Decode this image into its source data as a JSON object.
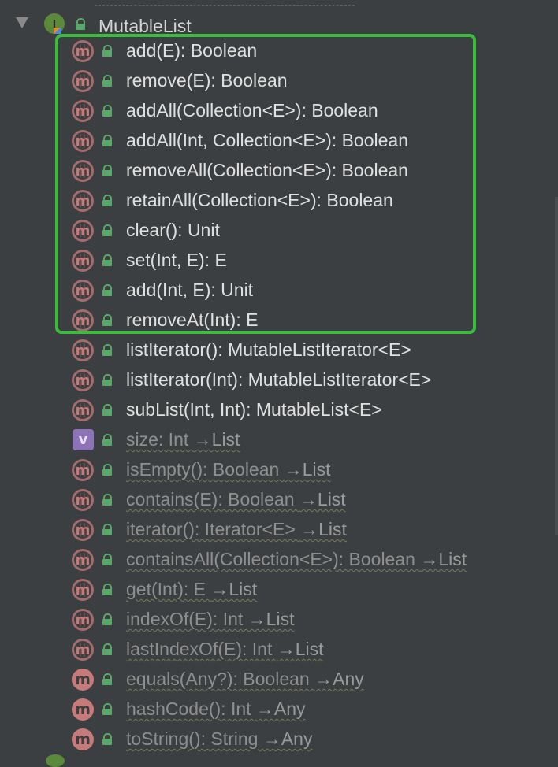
{
  "interface": {
    "title": "MutableList",
    "icon": "interface-icon",
    "expanded": true
  },
  "colors": {
    "background": "#3c3f41",
    "highlight_border": "#3cbb3c",
    "method_icon": "#c67a7a",
    "property_icon": "#8d72b8",
    "public_lock": "#59a869"
  },
  "members": [
    {
      "icon": "m",
      "kind": "method",
      "signature": "add(E): Boolean",
      "inherited": false,
      "abstract": true
    },
    {
      "icon": "m",
      "kind": "method",
      "signature": "remove(E): Boolean",
      "inherited": false,
      "abstract": true
    },
    {
      "icon": "m",
      "kind": "method",
      "signature": "addAll(Collection<E>): Boolean",
      "inherited": false,
      "abstract": true
    },
    {
      "icon": "m",
      "kind": "method",
      "signature": "addAll(Int, Collection<E>): Boolean",
      "inherited": false,
      "abstract": true
    },
    {
      "icon": "m",
      "kind": "method",
      "signature": "removeAll(Collection<E>): Boolean",
      "inherited": false,
      "abstract": true
    },
    {
      "icon": "m",
      "kind": "method",
      "signature": "retainAll(Collection<E>): Boolean",
      "inherited": false,
      "abstract": true
    },
    {
      "icon": "m",
      "kind": "method",
      "signature": "clear(): Unit",
      "inherited": false,
      "abstract": true
    },
    {
      "icon": "m",
      "kind": "method",
      "signature": "set(Int, E): E",
      "inherited": false,
      "abstract": true
    },
    {
      "icon": "m",
      "kind": "method",
      "signature": "add(Int, E): Unit",
      "inherited": false,
      "abstract": true
    },
    {
      "icon": "m",
      "kind": "method",
      "signature": "removeAt(Int): E",
      "inherited": false,
      "abstract": true
    },
    {
      "icon": "m",
      "kind": "method",
      "signature": "listIterator(): MutableListIterator<E>",
      "inherited": false,
      "abstract": true
    },
    {
      "icon": "m",
      "kind": "method",
      "signature": "listIterator(Int): MutableListIterator<E>",
      "inherited": false,
      "abstract": true
    },
    {
      "icon": "m",
      "kind": "method",
      "signature": "subList(Int, Int): MutableList<E>",
      "inherited": false,
      "abstract": true
    },
    {
      "icon": "v",
      "kind": "property",
      "signature": "size: Int ",
      "from": "→List",
      "inherited": true,
      "abstract": false
    },
    {
      "icon": "m",
      "kind": "method",
      "signature": "isEmpty(): Boolean ",
      "from": "→List",
      "inherited": true,
      "abstract": true
    },
    {
      "icon": "m",
      "kind": "method",
      "signature": "contains(E): Boolean ",
      "from": "→List",
      "inherited": true,
      "abstract": true
    },
    {
      "icon": "m",
      "kind": "method",
      "signature": "iterator(): Iterator<E> ",
      "from": "→List",
      "inherited": true,
      "abstract": true
    },
    {
      "icon": "m",
      "kind": "method",
      "signature": "containsAll(Collection<E>): Boolean ",
      "from": "→List",
      "inherited": true,
      "abstract": true
    },
    {
      "icon": "m",
      "kind": "method",
      "signature": "get(Int): E ",
      "from": "→List",
      "inherited": true,
      "abstract": true
    },
    {
      "icon": "m",
      "kind": "method",
      "signature": "indexOf(E): Int ",
      "from": "→List",
      "inherited": true,
      "abstract": true
    },
    {
      "icon": "m",
      "kind": "method",
      "signature": "lastIndexOf(E): Int ",
      "from": "→List",
      "inherited": true,
      "abstract": true
    },
    {
      "icon": "m",
      "kind": "method",
      "signature": "equals(Any?): Boolean ",
      "from": "→Any",
      "inherited": true,
      "abstract": false
    },
    {
      "icon": "m",
      "kind": "method",
      "signature": "hashCode(): Int ",
      "from": "→Any",
      "inherited": true,
      "abstract": false
    },
    {
      "icon": "m",
      "kind": "method",
      "signature": "toString(): String ",
      "from": "→Any",
      "inherited": true,
      "abstract": false
    }
  ]
}
